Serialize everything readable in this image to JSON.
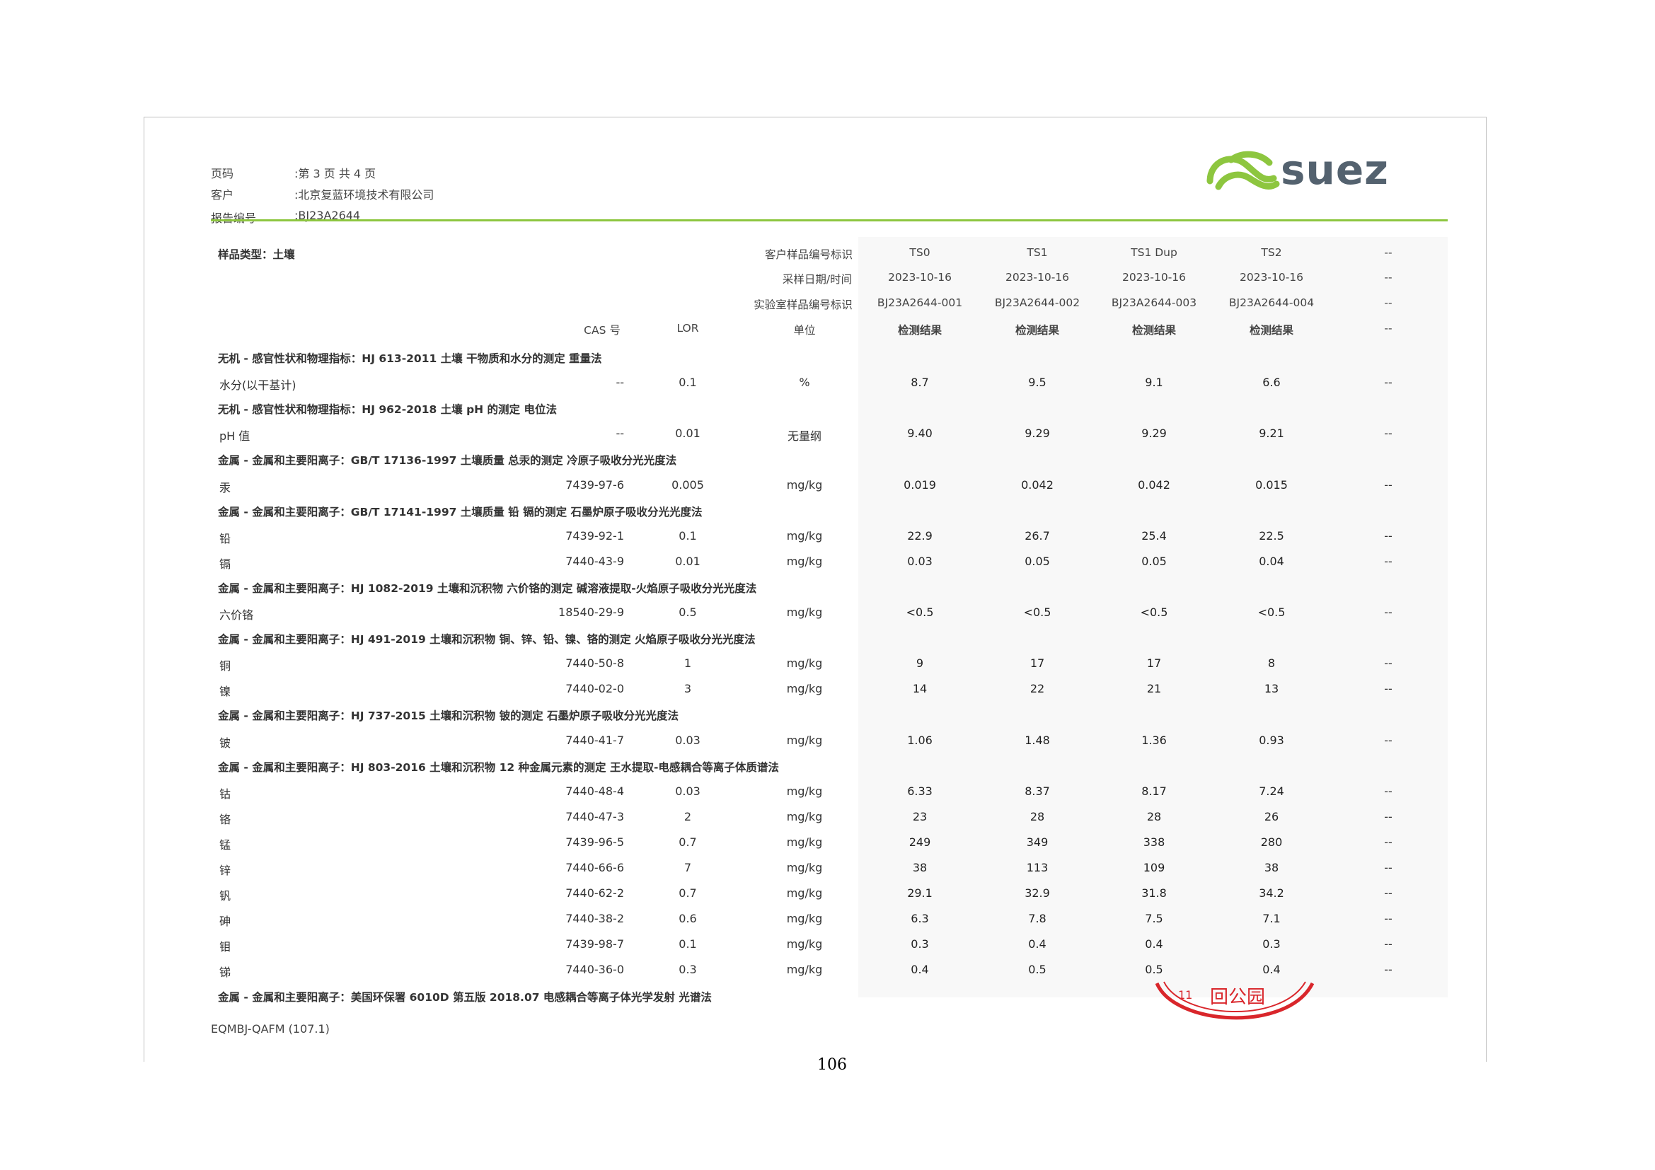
{
  "header": {
    "page_label": "页码",
    "page_value": ":第 3 页 共 4 页",
    "client_label": "客户",
    "client_value": ":北京复蓝环境技术有限公司",
    "report_label": "报告编号",
    "report_value": ":BJ23A2644"
  },
  "brand": {
    "name": "suez",
    "logo_icon": "suez-wave-icon",
    "accent_color": "#8dc63f",
    "text_color": "#54626f"
  },
  "table_meta": {
    "sample_type": "样品类型：土壤",
    "client_id_label": "客户样品编号标识",
    "sample_date_label": "采样日期/时间",
    "lab_id_label": "实验室样品编号标识",
    "cas_label": "CAS 号",
    "lor_label": "LOR",
    "unit_label": "单位",
    "columns": [
      {
        "client_id": "TS0",
        "date": "2023-10-16",
        "lab_id": "BJ23A2644-001",
        "result_label": "检测结果"
      },
      {
        "client_id": "TS1",
        "date": "2023-10-16",
        "lab_id": "BJ23A2644-002",
        "result_label": "检测结果"
      },
      {
        "client_id": "TS1 Dup",
        "date": "2023-10-16",
        "lab_id": "BJ23A2644-003",
        "result_label": "检测结果"
      },
      {
        "client_id": "TS2",
        "date": "2023-10-16",
        "lab_id": "BJ23A2644-004",
        "result_label": "检测结果"
      }
    ],
    "extra_col": "--"
  },
  "rows": [
    {
      "kind": "section",
      "text": "无机 - 感官性状和物理指标：HJ 613-2011 土壤 干物质和水分的测定 重量法"
    },
    {
      "kind": "data",
      "name": "水分(以干基计)",
      "cas": "--",
      "lor": "0.1",
      "unit": "%",
      "vals": [
        "8.7",
        "9.5",
        "9.1",
        "6.6"
      ],
      "extra": "--"
    },
    {
      "kind": "section",
      "text": "无机 - 感官性状和物理指标：HJ 962-2018 土壤 pH 的测定 电位法"
    },
    {
      "kind": "data",
      "name": "pH 值",
      "cas": "--",
      "lor": "0.01",
      "unit": "无量纲",
      "vals": [
        "9.40",
        "9.29",
        "9.29",
        "9.21"
      ],
      "extra": "--"
    },
    {
      "kind": "section",
      "text": "金属 - 金属和主要阳离子：GB/T 17136-1997 土壤质量 总汞的测定 冷原子吸收分光光度法"
    },
    {
      "kind": "data",
      "name": "汞",
      "cas": "7439-97-6",
      "lor": "0.005",
      "unit": "mg/kg",
      "vals": [
        "0.019",
        "0.042",
        "0.042",
        "0.015"
      ],
      "extra": "--"
    },
    {
      "kind": "section",
      "text": "金属 - 金属和主要阳离子：GB/T 17141-1997 土壤质量 铅 镉的测定 石墨炉原子吸收分光光度法"
    },
    {
      "kind": "data",
      "name": "铅",
      "cas": "7439-92-1",
      "lor": "0.1",
      "unit": "mg/kg",
      "vals": [
        "22.9",
        "26.7",
        "25.4",
        "22.5"
      ],
      "extra": "--"
    },
    {
      "kind": "data",
      "name": "镉",
      "cas": "7440-43-9",
      "lor": "0.01",
      "unit": "mg/kg",
      "vals": [
        "0.03",
        "0.05",
        "0.05",
        "0.04"
      ],
      "extra": "--"
    },
    {
      "kind": "section",
      "text": "金属 - 金属和主要阳离子：HJ 1082-2019 土壤和沉积物 六价铬的测定 碱溶液提取-火焰原子吸收分光光度法"
    },
    {
      "kind": "data",
      "name": "六价铬",
      "cas": "18540-29-9",
      "lor": "0.5",
      "unit": "mg/kg",
      "vals": [
        "<0.5",
        "<0.5",
        "<0.5",
        "<0.5"
      ],
      "extra": "--"
    },
    {
      "kind": "section",
      "text": "金属 - 金属和主要阳离子：HJ 491-2019 土壤和沉积物 铜、锌、铅、镍、铬的测定 火焰原子吸收分光光度法"
    },
    {
      "kind": "data",
      "name": "铜",
      "cas": "7440-50-8",
      "lor": "1",
      "unit": "mg/kg",
      "vals": [
        "9",
        "17",
        "17",
        "8"
      ],
      "extra": "--"
    },
    {
      "kind": "data",
      "name": "镍",
      "cas": "7440-02-0",
      "lor": "3",
      "unit": "mg/kg",
      "vals": [
        "14",
        "22",
        "21",
        "13"
      ],
      "extra": "--"
    },
    {
      "kind": "section",
      "text": "金属 - 金属和主要阳离子：HJ 737-2015 土壤和沉积物 铍的测定 石墨炉原子吸收分光光度法"
    },
    {
      "kind": "data",
      "name": "铍",
      "cas": "7440-41-7",
      "lor": "0.03",
      "unit": "mg/kg",
      "vals": [
        "1.06",
        "1.48",
        "1.36",
        "0.93"
      ],
      "extra": "--"
    },
    {
      "kind": "section",
      "text": "金属 - 金属和主要阳离子：HJ 803-2016 土壤和沉积物 12 种金属元素的测定 王水提取-电感耦合等离子体质谱法"
    },
    {
      "kind": "data",
      "name": "钴",
      "cas": "7440-48-4",
      "lor": "0.03",
      "unit": "mg/kg",
      "vals": [
        "6.33",
        "8.37",
        "8.17",
        "7.24"
      ],
      "extra": "--"
    },
    {
      "kind": "data",
      "name": "铬",
      "cas": "7440-47-3",
      "lor": "2",
      "unit": "mg/kg",
      "vals": [
        "23",
        "28",
        "28",
        "26"
      ],
      "extra": "--"
    },
    {
      "kind": "data",
      "name": "锰",
      "cas": "7439-96-5",
      "lor": "0.7",
      "unit": "mg/kg",
      "vals": [
        "249",
        "349",
        "338",
        "280"
      ],
      "extra": "--"
    },
    {
      "kind": "data",
      "name": "锌",
      "cas": "7440-66-6",
      "lor": "7",
      "unit": "mg/kg",
      "vals": [
        "38",
        "113",
        "109",
        "38"
      ],
      "extra": "--"
    },
    {
      "kind": "data",
      "name": "钒",
      "cas": "7440-62-2",
      "lor": "0.7",
      "unit": "mg/kg",
      "vals": [
        "29.1",
        "32.9",
        "31.8",
        "34.2"
      ],
      "extra": "--"
    },
    {
      "kind": "data",
      "name": "砷",
      "cas": "7440-38-2",
      "lor": "0.6",
      "unit": "mg/kg",
      "vals": [
        "6.3",
        "7.8",
        "7.5",
        "7.1"
      ],
      "extra": "--"
    },
    {
      "kind": "data",
      "name": "钼",
      "cas": "7439-98-7",
      "lor": "0.1",
      "unit": "mg/kg",
      "vals": [
        "0.3",
        "0.4",
        "0.4",
        "0.3"
      ],
      "extra": "--"
    },
    {
      "kind": "data",
      "name": "锑",
      "cas": "7440-36-0",
      "lor": "0.3",
      "unit": "mg/kg",
      "vals": [
        "0.4",
        "0.5",
        "0.5",
        "0.4"
      ],
      "extra": "--"
    },
    {
      "kind": "section",
      "text": "金属 - 金属和主要阳离子：美国环保署 6010D 第五版 2018.07 电感耦合等离子体光学发射 光谱法"
    }
  ],
  "footer": {
    "form_code": "EQMBJ-QAFM (107.1)",
    "page_number": "106"
  },
  "stamp": {
    "visible_text": "11 回公园",
    "color": "#d9262b"
  }
}
